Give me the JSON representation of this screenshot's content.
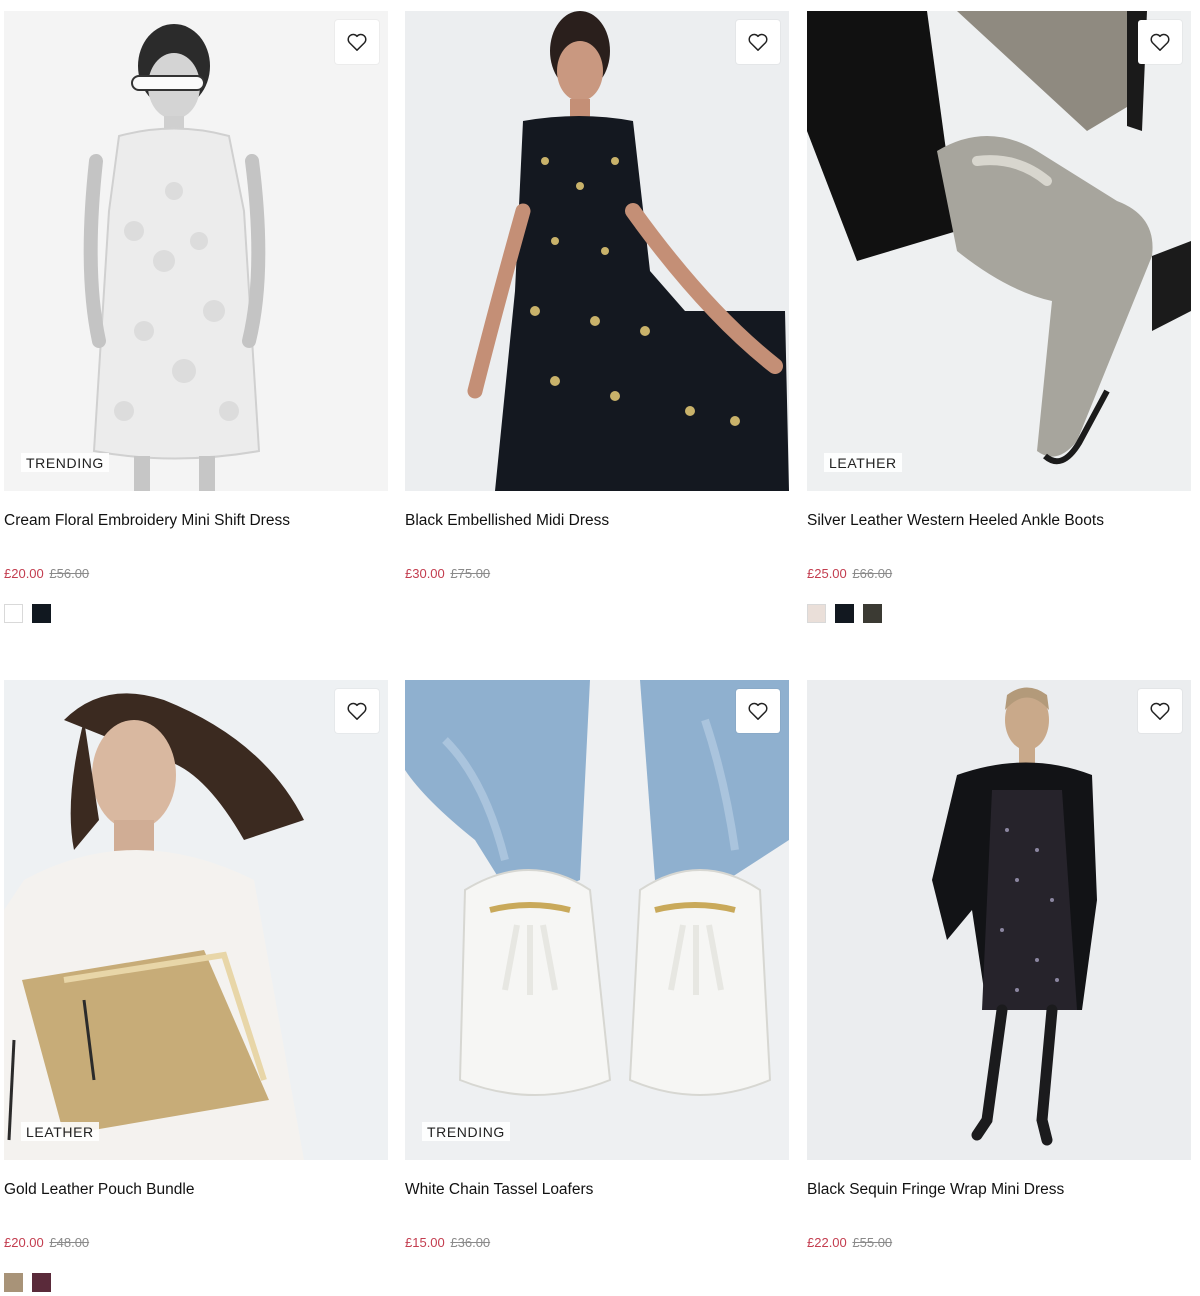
{
  "products": [
    {
      "title": "Cream Floral Embroidery Mini Shift Dress",
      "badge": "TRENDING",
      "price": "£20.00",
      "was_price": "£56.00",
      "swatches": [
        "#ffffff",
        "#111820"
      ],
      "image": "white-embroidered-dress-photo"
    },
    {
      "title": "Black Embellished Midi Dress",
      "badge": "",
      "price": "£30.00",
      "was_price": "£75.00",
      "swatches": [],
      "image": "black-embellished-dress-photo"
    },
    {
      "title": "Silver Leather Western Heeled Ankle Boots",
      "badge": "LEATHER",
      "price": "£25.00",
      "was_price": "£66.00",
      "swatches": [
        "#eadfd9",
        "#121820",
        "#3b3a33"
      ],
      "image": "silver-ankle-boot-photo"
    },
    {
      "title": "Gold Leather Pouch Bundle",
      "badge": "LEATHER",
      "price": "£20.00",
      "was_price": "£48.00",
      "swatches": [
        "#a89378",
        "#5a2a3a"
      ],
      "image": "gold-pouch-photo"
    },
    {
      "title": "White Chain Tassel Loafers",
      "badge": "TRENDING",
      "price": "£15.00",
      "was_price": "£36.00",
      "swatches": [],
      "image": "white-loafers-photo"
    },
    {
      "title": "Black Sequin Fringe Wrap Mini Dress",
      "badge": "",
      "price": "£22.00",
      "was_price": "£55.00",
      "swatches": [],
      "image": "black-sequin-dress-photo"
    }
  ],
  "colors": {
    "sale": "#c33d4f",
    "was": "#8a8a8a",
    "image_bg": "#eef1f3"
  }
}
